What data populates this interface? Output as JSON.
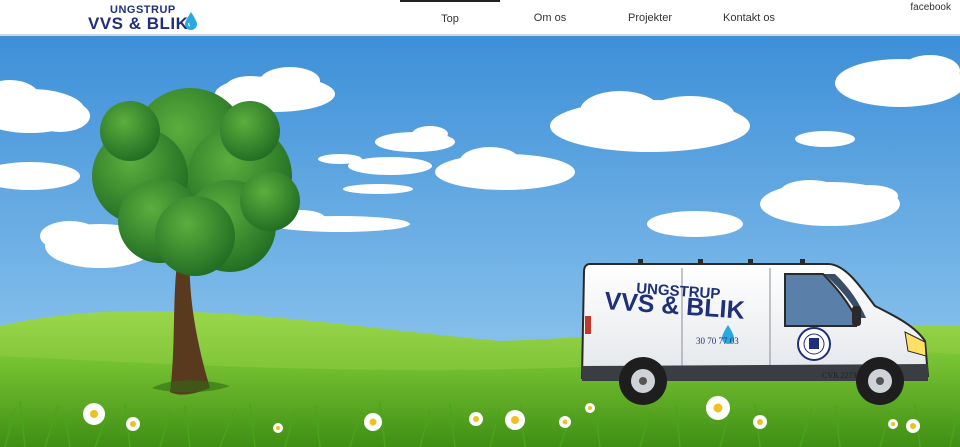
{
  "logo": {
    "line1": "UNGSTRUP",
    "line2": "VVS & BLIK"
  },
  "nav": {
    "items": [
      {
        "label": "Top",
        "active": true
      },
      {
        "label": "Om os",
        "active": false
      },
      {
        "label": "Projekter",
        "active": false
      },
      {
        "label": "Kontakt os",
        "active": false
      }
    ]
  },
  "social": {
    "facebook_label": "facebook"
  },
  "hero": {
    "van": {
      "brand_line1": "UNGSTRUP",
      "brand_line2": "VVS & BLIK",
      "phone": "30 70 77 03",
      "cvr": "CVR 2273"
    }
  },
  "colors": {
    "brand_blue": "#1f2f7a",
    "sky_top": "#3d8fd8",
    "sky_bottom": "#9ed0f2",
    "grass": "#6dbb2a",
    "drop_blue": "#2aa9e0"
  },
  "icons": {
    "logo_drop": "water-drop-icon",
    "van_drop": "water-drop-icon",
    "van_emblem": "circle-emblem-icon"
  }
}
